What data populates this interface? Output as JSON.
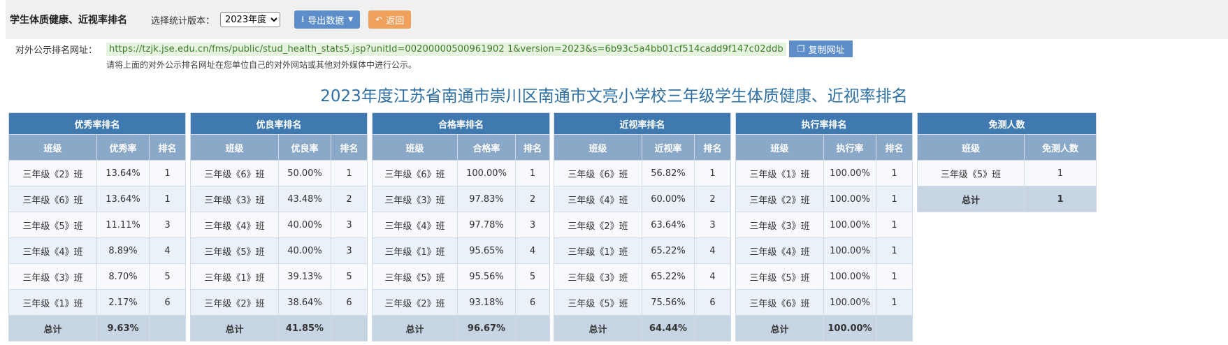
{
  "header": {
    "title": "学生体质健康、近视率排名",
    "version_label": "选择统计版本：",
    "version_selected": "2023年度",
    "export_label": "导出数据",
    "back_label": "返回"
  },
  "public_url": {
    "label": "对外公示排名网址：",
    "url": "https://tzjk.jse.edu.cn/fms/public/stud_health_stats5.jsp?unitId=00200000500961902 1&version=2023&s=6b93c5a4bb01cf514cadd9f147c02ddb",
    "copy_label": "复制网址",
    "hint": "请将上面的对外公示排名网址在您单位自己的对外网站或其他对外媒体中进行公示。"
  },
  "report_title": "2023年度江苏省南通市崇川区南通市文亮小学校三年级学生体质健康、近视率排名",
  "tables": [
    {
      "title": "优秀率排名",
      "cols": [
        "班级",
        "优秀率",
        "排名"
      ],
      "rows": [
        [
          "三年级《2》班",
          "13.64%",
          "1"
        ],
        [
          "三年级《6》班",
          "13.64%",
          "1"
        ],
        [
          "三年级《5》班",
          "11.11%",
          "3"
        ],
        [
          "三年级《4》班",
          "8.89%",
          "4"
        ],
        [
          "三年级《3》班",
          "8.70%",
          "5"
        ],
        [
          "三年级《1》班",
          "2.17%",
          "6"
        ]
      ],
      "total": [
        "总计",
        "9.63%",
        ""
      ]
    },
    {
      "title": "优良率排名",
      "cols": [
        "班级",
        "优良率",
        "排名"
      ],
      "rows": [
        [
          "三年级《6》班",
          "50.00%",
          "1"
        ],
        [
          "三年级《3》班",
          "43.48%",
          "2"
        ],
        [
          "三年级《4》班",
          "40.00%",
          "3"
        ],
        [
          "三年级《5》班",
          "40.00%",
          "3"
        ],
        [
          "三年级《1》班",
          "39.13%",
          "5"
        ],
        [
          "三年级《2》班",
          "38.64%",
          "6"
        ]
      ],
      "total": [
        "总计",
        "41.85%",
        ""
      ]
    },
    {
      "title": "合格率排名",
      "cols": [
        "班级",
        "合格率",
        "排名"
      ],
      "rows": [
        [
          "三年级《6》班",
          "100.00%",
          "1"
        ],
        [
          "三年级《3》班",
          "97.83%",
          "2"
        ],
        [
          "三年级《4》班",
          "97.78%",
          "3"
        ],
        [
          "三年级《1》班",
          "95.65%",
          "4"
        ],
        [
          "三年级《5》班",
          "95.56%",
          "5"
        ],
        [
          "三年级《2》班",
          "93.18%",
          "6"
        ]
      ],
      "total": [
        "总计",
        "96.67%",
        ""
      ]
    },
    {
      "title": "近视率排名",
      "cols": [
        "班级",
        "近视率",
        "排名"
      ],
      "rows": [
        [
          "三年级《6》班",
          "56.82%",
          "1"
        ],
        [
          "三年级《4》班",
          "60.00%",
          "2"
        ],
        [
          "三年级《2》班",
          "63.64%",
          "3"
        ],
        [
          "三年级《1》班",
          "65.22%",
          "4"
        ],
        [
          "三年级《3》班",
          "65.22%",
          "4"
        ],
        [
          "三年级《5》班",
          "75.56%",
          "6"
        ]
      ],
      "total": [
        "总计",
        "64.44%",
        ""
      ]
    },
    {
      "title": "执行率排名",
      "cols": [
        "班级",
        "执行率",
        "排名"
      ],
      "rows": [
        [
          "三年级《1》班",
          "100.00%",
          "1"
        ],
        [
          "三年级《2》班",
          "100.00%",
          "1"
        ],
        [
          "三年级《3》班",
          "100.00%",
          "1"
        ],
        [
          "三年级《4》班",
          "100.00%",
          "1"
        ],
        [
          "三年级《5》班",
          "100.00%",
          "1"
        ],
        [
          "三年级《6》班",
          "100.00%",
          "1"
        ]
      ],
      "total": [
        "总计",
        "100.00%",
        ""
      ]
    },
    {
      "title": "免测人数",
      "cols": [
        "班级",
        "免测人数"
      ],
      "rows": [
        [
          "三年级《5》班",
          "1"
        ]
      ],
      "total": [
        "总计",
        "1"
      ]
    }
  ]
}
